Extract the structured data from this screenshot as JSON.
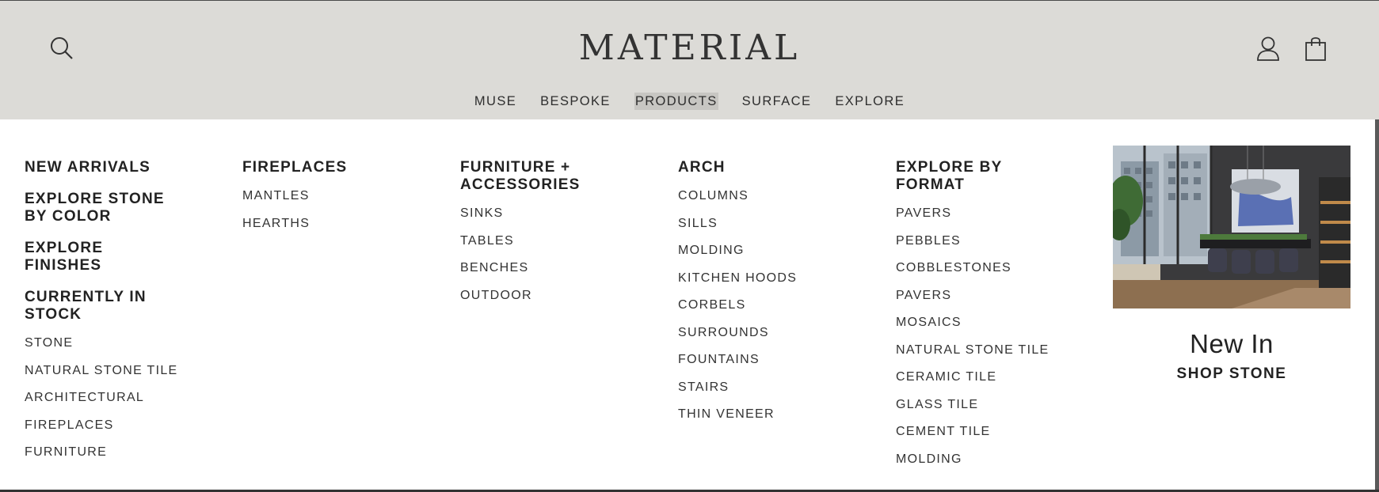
{
  "header": {
    "logo": "MATERIAL",
    "nav": [
      "MUSE",
      "BESPOKE",
      "PRODUCTS",
      "SURFACE",
      "EXPLORE"
    ],
    "active_nav": "PRODUCTS",
    "icons": [
      "search-icon",
      "account-icon",
      "cart-icon"
    ]
  },
  "menu": {
    "col1": {
      "headings": [
        "NEW ARRIVALS",
        "EXPLORE STONE BY COLOR",
        "EXPLORE FINISHES",
        "CURRENTLY IN STOCK"
      ],
      "links": [
        "STONE",
        "NATURAL STONE TILE",
        "ARCHITECTURAL",
        "FIREPLACES",
        "FURNITURE"
      ]
    },
    "col2": {
      "heading": "FIREPLACES",
      "links": [
        "MANTLES",
        "HEARTHS"
      ]
    },
    "col3": {
      "heading": "FURNITURE + ACCESSORIES",
      "links": [
        "SINKS",
        "TABLES",
        "BENCHES",
        "OUTDOOR"
      ]
    },
    "col4": {
      "heading": "ARCH",
      "links": [
        "COLUMNS",
        "SILLS",
        "MOLDING",
        "KITCHEN HOODS",
        "CORBELS",
        "SURROUNDS",
        "FOUNTAINS",
        "STAIRS",
        "THIN VENEER"
      ]
    },
    "col5": {
      "heading": "EXPLORE BY FORMAT",
      "links": [
        "PAVERS",
        "PEBBLES",
        "COBBLESTONES",
        "PAVERS",
        "MOSAICS",
        "NATURAL STONE TILE",
        "CERAMIC TILE",
        "GLASS TILE",
        "CEMENT TILE",
        "MOLDING"
      ]
    }
  },
  "promo": {
    "title": "New In",
    "link": "SHOP STONE"
  },
  "colors": {
    "header_bg": "#dcdbd7",
    "panel_bg": "#ffffff",
    "text": "#222222"
  }
}
